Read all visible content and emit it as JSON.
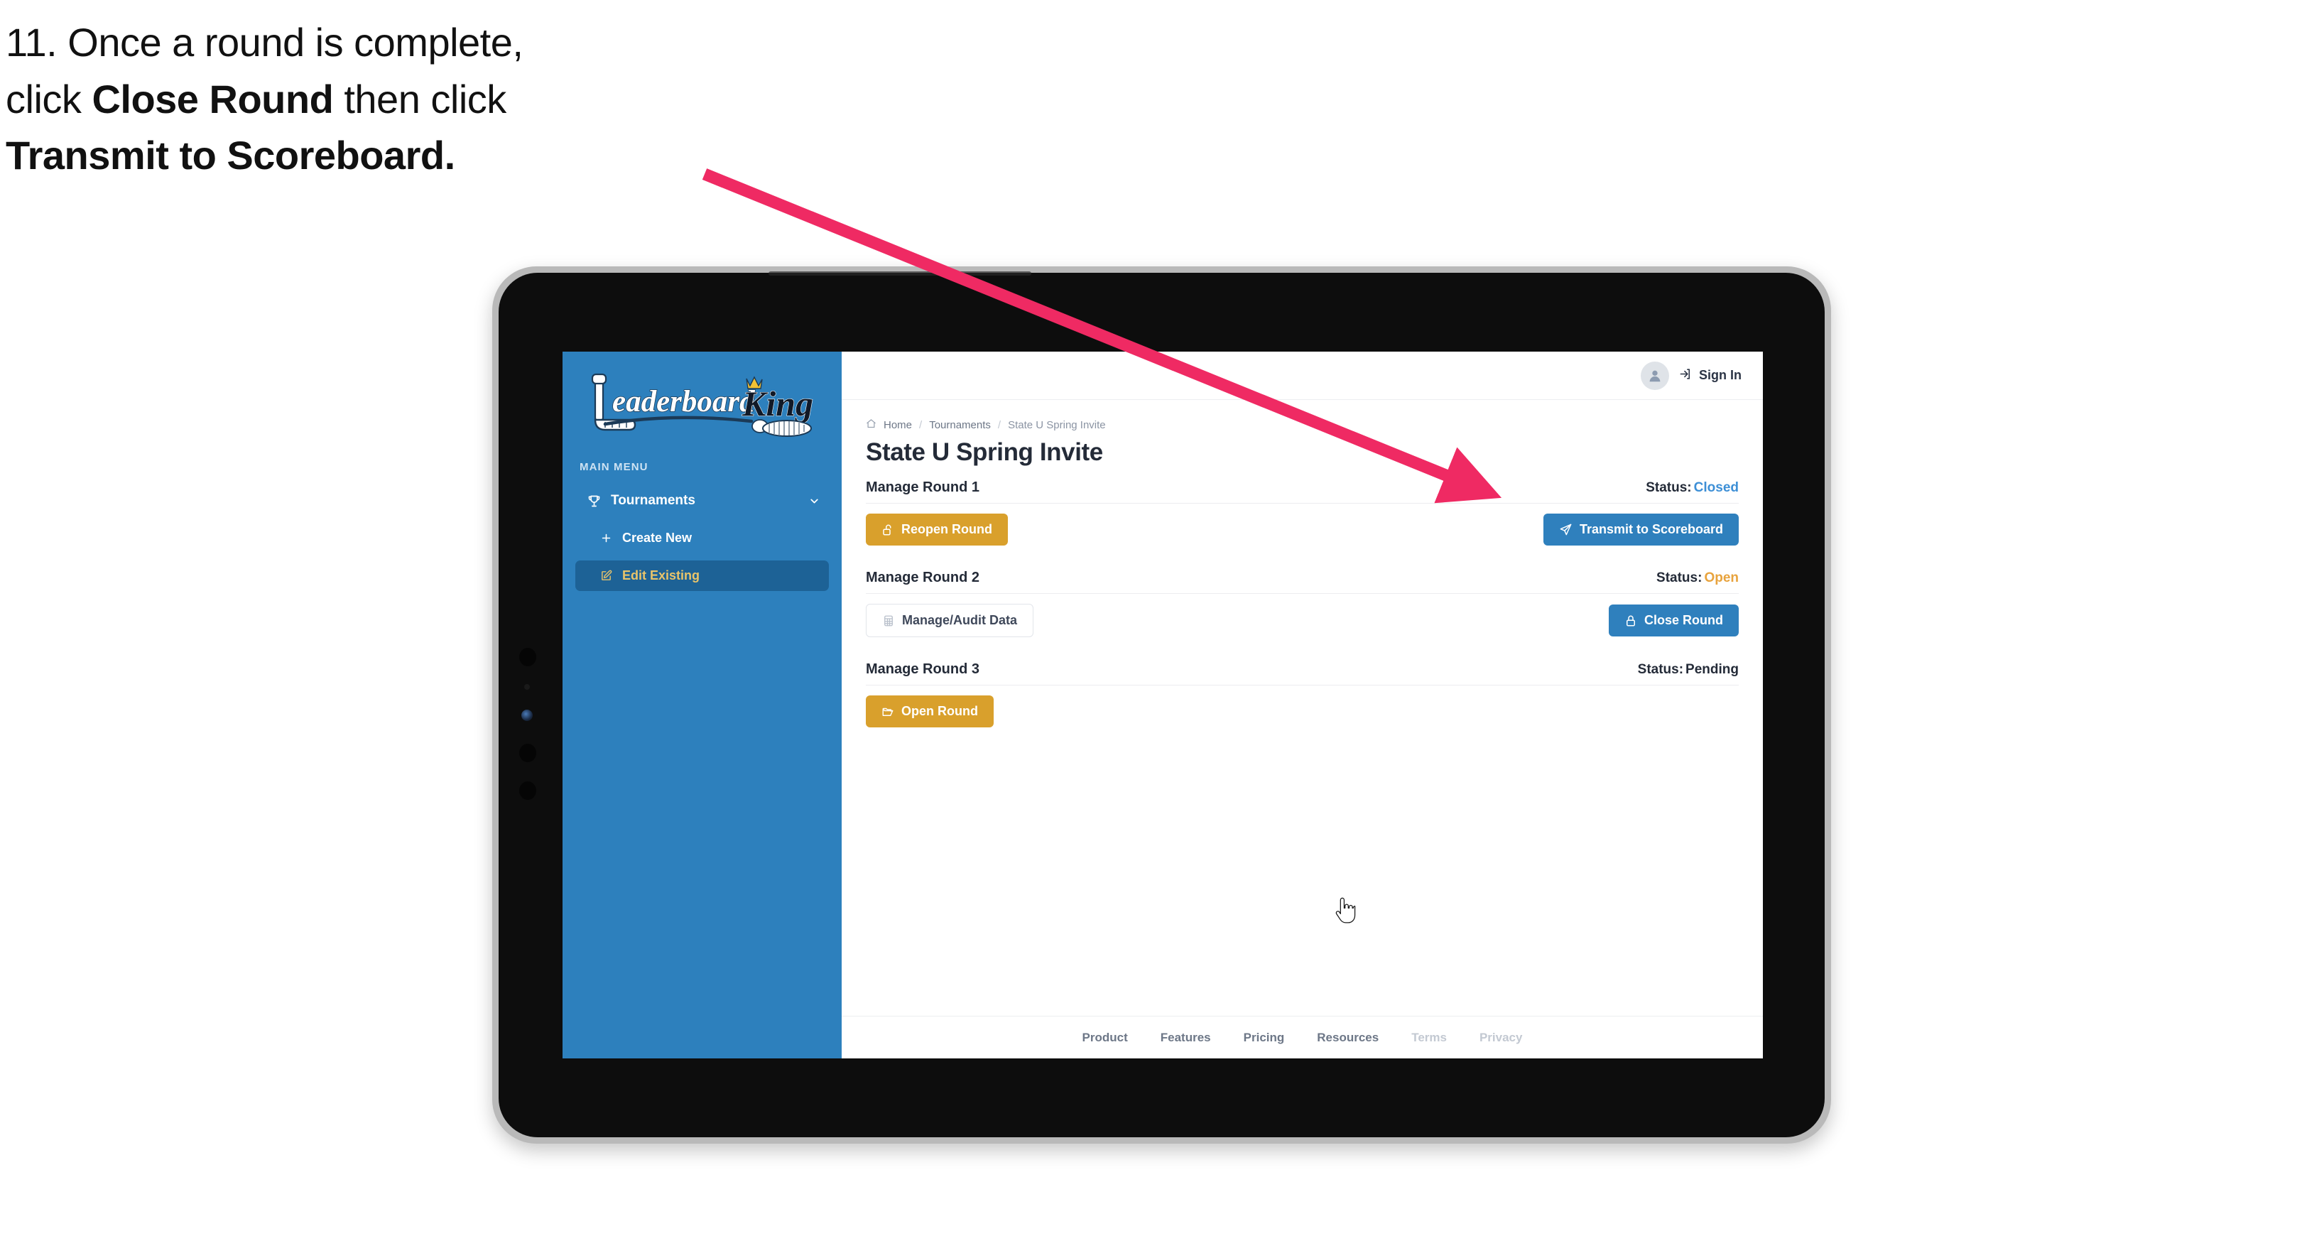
{
  "caption": {
    "line1_num": "11.",
    "line1": "Once a round is complete,",
    "line2_pre": "click ",
    "line2_bold": "Close Round",
    "line2_post": " then click",
    "line3_bold": "Transmit to Scoreboard."
  },
  "colors": {
    "sidebar_blue": "#2d80bd",
    "sidebar_active": "#1d6296",
    "sidebar_active_text": "#e9c46a",
    "primary_blue": "#2f80bd",
    "gold": "#d9a02c",
    "status_closed": "#3d8fd6",
    "status_open": "#e8a33d",
    "status_pending": "#242b38",
    "arrow_pink": "#ef2a63",
    "text_dark": "#242b38",
    "text_muted": "#6d7787"
  },
  "sidebar": {
    "logo_primary": "Leaderboard",
    "logo_secondary": "King",
    "section_label": "MAIN MENU",
    "nav": {
      "label": "Tournaments",
      "icon": "trophy-icon",
      "chevron": "chevron-down-icon"
    },
    "sub_items": [
      {
        "label": "Create New",
        "icon": "plus-icon",
        "active": false
      },
      {
        "label": "Edit Existing",
        "icon": "edit-square-icon",
        "active": true
      }
    ]
  },
  "topbar": {
    "avatar_icon": "user-avatar-icon",
    "signin_icon": "sign-in-icon",
    "signin_label": "Sign In"
  },
  "breadcrumb": {
    "home_icon": "home-icon",
    "items": [
      "Home",
      "Tournaments",
      "State U Spring Invite"
    ],
    "separator": "/"
  },
  "page": {
    "title": "State U Spring Invite"
  },
  "rounds": [
    {
      "title": "Manage Round 1",
      "status_label": "Status:",
      "status_value": "Closed",
      "status_color": "#3d8fd6",
      "left_button": {
        "label": "Reopen Round",
        "icon": "unlock-icon",
        "style": "gold"
      },
      "right_button": {
        "label": "Transmit to Scoreboard",
        "icon": "paper-plane-icon",
        "style": "blue"
      }
    },
    {
      "title": "Manage Round 2",
      "status_label": "Status:",
      "status_value": "Open",
      "status_color": "#e8a33d",
      "left_button": {
        "label": "Manage/Audit Data",
        "icon": "table-grid-icon",
        "style": "ghost"
      },
      "right_button": {
        "label": "Close Round",
        "icon": "lock-icon",
        "style": "blue"
      }
    },
    {
      "title": "Manage Round 3",
      "status_label": "Status:",
      "status_value": "Pending",
      "status_color": "#242b38",
      "left_button": {
        "label": "Open Round",
        "icon": "folder-open-icon",
        "style": "gold"
      },
      "right_button": null
    }
  ],
  "footer": {
    "links": [
      {
        "label": "Product",
        "muted": false
      },
      {
        "label": "Features",
        "muted": false
      },
      {
        "label": "Pricing",
        "muted": false
      },
      {
        "label": "Resources",
        "muted": false
      },
      {
        "label": "Terms",
        "muted": true
      },
      {
        "label": "Privacy",
        "muted": true
      }
    ]
  },
  "annotation": {
    "arrow_icon": "pointer-arrow-icon",
    "cursor_icon": "pointing-hand-cursor-icon"
  }
}
